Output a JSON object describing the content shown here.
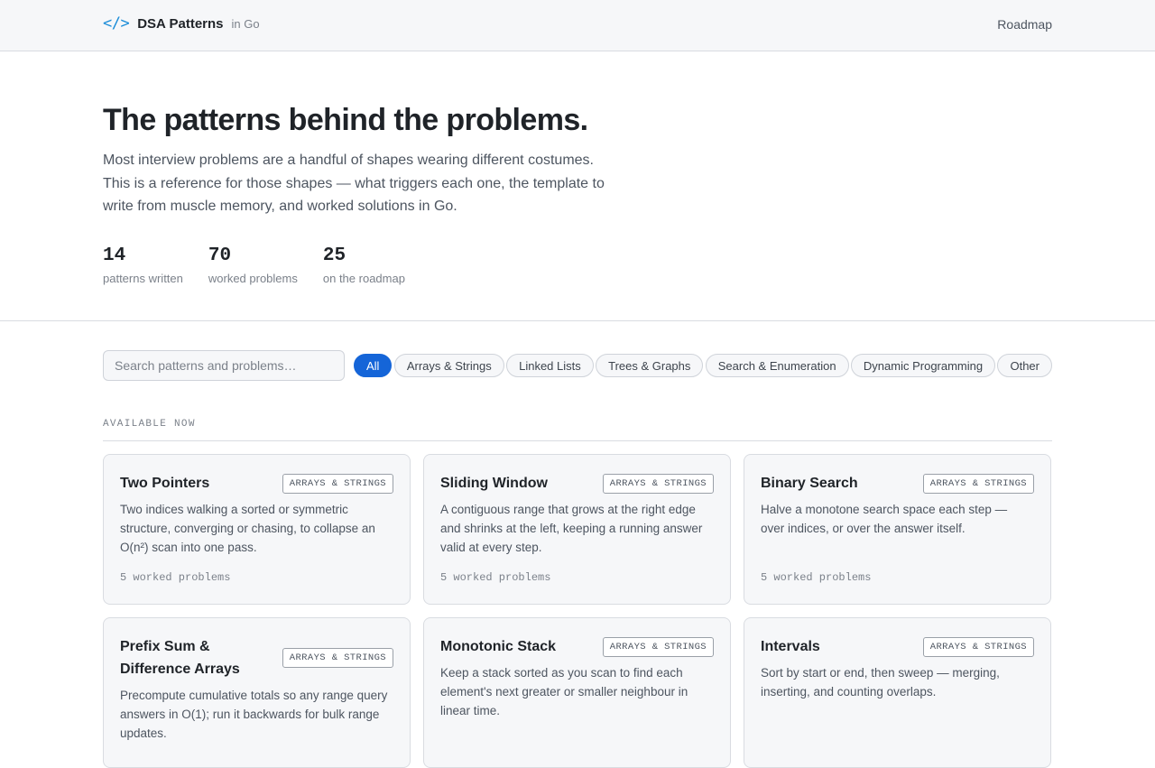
{
  "header": {
    "logo_glyph": "</>",
    "brand_name": "DSA Patterns",
    "brand_sub": "in Go",
    "nav_roadmap": "Roadmap"
  },
  "hero": {
    "title": "The patterns behind the problems.",
    "lede": "Most interview problems are a handful of shapes wearing different costumes. This is a reference for those shapes — what triggers each one, the template to write from muscle memory, and worked solutions in Go.",
    "stats": [
      {
        "value": "14",
        "label": "patterns written"
      },
      {
        "value": "70",
        "label": "worked problems"
      },
      {
        "value": "25",
        "label": "on the roadmap"
      }
    ]
  },
  "filters": {
    "search_placeholder": "Search patterns and problems…",
    "pills": [
      {
        "label": "All",
        "active": true
      },
      {
        "label": "Arrays & Strings",
        "active": false
      },
      {
        "label": "Linked Lists",
        "active": false
      },
      {
        "label": "Trees & Graphs",
        "active": false
      },
      {
        "label": "Search & Enumeration",
        "active": false
      },
      {
        "label": "Dynamic Programming",
        "active": false
      },
      {
        "label": "Other",
        "active": false
      }
    ]
  },
  "section": {
    "label": "AVAILABLE NOW"
  },
  "cards": [
    {
      "title": "Two Pointers",
      "tag": "ARRAYS & STRINGS",
      "desc": "Two indices walking a sorted or symmetric structure, converging or chasing, to collapse an O(n²) scan into one pass.",
      "count": "5 worked problems"
    },
    {
      "title": "Sliding Window",
      "tag": "ARRAYS & STRINGS",
      "desc": "A contiguous range that grows at the right edge and shrinks at the left, keeping a running answer valid at every step.",
      "count": "5 worked problems"
    },
    {
      "title": "Binary Search",
      "tag": "ARRAYS & STRINGS",
      "desc": "Halve a monotone search space each step — over indices, or over the answer itself.",
      "count": "5 worked problems"
    },
    {
      "title": "Prefix Sum & Difference Arrays",
      "tag": "ARRAYS & STRINGS",
      "desc": "Precompute cumulative totals so any range query answers in O(1); run it backwards for bulk range updates.",
      "count": ""
    },
    {
      "title": "Monotonic Stack",
      "tag": "ARRAYS & STRINGS",
      "desc": "Keep a stack sorted as you scan to find each element's next greater or smaller neighbour in linear time.",
      "count": ""
    },
    {
      "title": "Intervals",
      "tag": "ARRAYS & STRINGS",
      "desc": "Sort by start or end, then sweep — merging, inserting, and counting overlaps.",
      "count": ""
    }
  ]
}
